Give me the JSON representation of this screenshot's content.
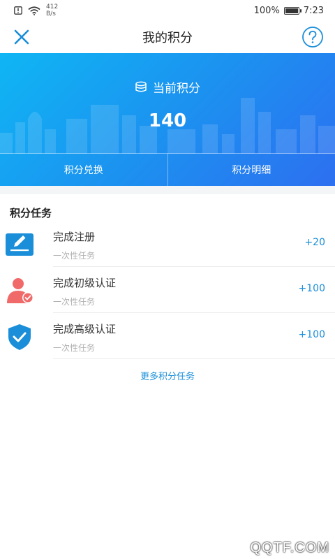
{
  "status_bar": {
    "network_speed_value": "412",
    "network_speed_unit": "B/s",
    "battery_percent": "100%",
    "battery_level": 1.0,
    "time": "7:23"
  },
  "nav": {
    "title": "我的积分",
    "close_icon": "close-icon",
    "help_icon": "help-icon"
  },
  "balance": {
    "label": "当前积分",
    "value": "140"
  },
  "banner_tabs": [
    {
      "label": "积分兑换"
    },
    {
      "label": "积分明细"
    }
  ],
  "tasks": {
    "title": "积分任务",
    "items": [
      {
        "name": "完成注册",
        "type": "一次性任务",
        "points": "+20",
        "icon": "edit-icon"
      },
      {
        "name": "完成初级认证",
        "type": "一次性任务",
        "points": "+100",
        "icon": "user-verified-icon"
      },
      {
        "name": "完成高级认证",
        "type": "一次性任务",
        "points": "+100",
        "icon": "shield-check-icon"
      }
    ],
    "more_label": "更多积分任务"
  },
  "watermark": "QQTF.COM",
  "colors": {
    "accent": "#1a8ed8",
    "banner_start": "#0fb6f4",
    "banner_end": "#2d6ff0",
    "user_icon": "#f06a6a"
  }
}
